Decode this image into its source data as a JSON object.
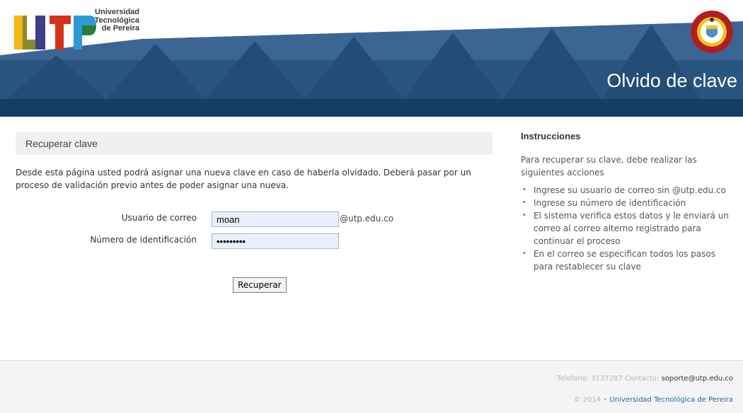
{
  "header": {
    "logo_lines": [
      "Universidad",
      "Tecnológica",
      "de Pereira"
    ],
    "page_title": "Olvido de clave",
    "colors": {
      "banner": "#1f4b78",
      "banner_light": "#3b6694",
      "bar": "#163d64"
    }
  },
  "recover": {
    "section_title": "Recuperar clave",
    "intro": "Desde esta página usted podrá asignar una nueva clave en caso de haberla olvidado. Deberá pasar por un proceso de validación previo antes de poder asignar una nueva.",
    "email_label": "Usuario de correo",
    "email_value": "moan",
    "email_suffix": "@utp.edu.co",
    "id_label": "Número de identificación",
    "id_value": "•••••••••",
    "submit_label": "Recuperar"
  },
  "instructions": {
    "title": "Instrucciones",
    "intro": "Para recuperar su clave, debe realizar las siguientes acciones",
    "items": [
      "Ingrese su usuario de correo sin @utp.edu.co",
      "Ingrese su número de identificación",
      "El sistema verifica estos datos y le enviará un correo al correo alterno registrado para continuar el proceso",
      "En el correo se especifican todos los pasos para restablecer su clave"
    ]
  },
  "footer": {
    "phone_text": "Telefono: 3137287 Contacto:",
    "contact_email": "soporte@utp.edu.co",
    "copyright": "© 2014 •",
    "university_link": "Universidad Tecnológica de Pereira"
  }
}
